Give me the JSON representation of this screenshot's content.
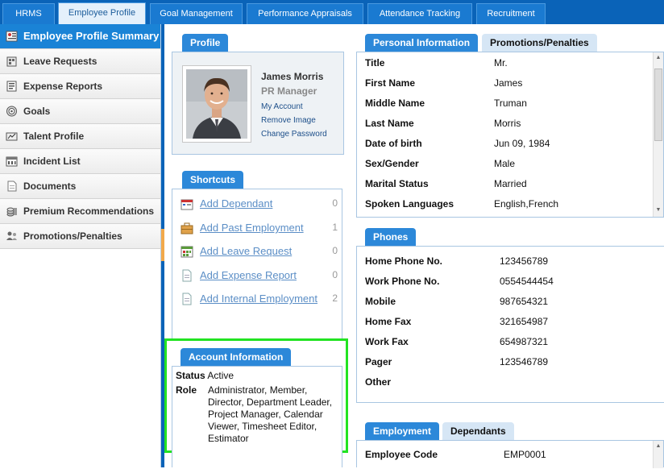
{
  "nav": {
    "tabs": [
      {
        "label": "HRMS"
      },
      {
        "label": "Employee Profile"
      },
      {
        "label": "Goal Management"
      },
      {
        "label": "Performance Appraisals"
      },
      {
        "label": "Attendance Tracking"
      },
      {
        "label": "Recruitment"
      }
    ]
  },
  "sidebar": {
    "items": [
      {
        "label": "Employee Profile Summary",
        "icon": "profile-summary-icon"
      },
      {
        "label": "Leave Requests",
        "icon": "leave-icon"
      },
      {
        "label": "Expense Reports",
        "icon": "expense-icon"
      },
      {
        "label": "Goals",
        "icon": "goals-icon"
      },
      {
        "label": "Talent Profile",
        "icon": "talent-icon"
      },
      {
        "label": "Incident List",
        "icon": "incident-icon"
      },
      {
        "label": "Documents",
        "icon": "documents-icon"
      },
      {
        "label": "Premium Recommendations",
        "icon": "premium-icon"
      },
      {
        "label": "Promotions/Penalties",
        "icon": "promotions-icon"
      }
    ]
  },
  "profile": {
    "tab": "Profile",
    "name": "James Morris",
    "role": "PR Manager",
    "links": [
      "My Account",
      "Remove Image",
      "Change Password"
    ]
  },
  "shortcuts": {
    "tab": "Shortcuts",
    "items": [
      {
        "label": "Add Dependant",
        "count": "0"
      },
      {
        "label": "Add Past Employment",
        "count": "1"
      },
      {
        "label": "Add Leave Request",
        "count": "0"
      },
      {
        "label": "Add Expense Report",
        "count": "0"
      },
      {
        "label": "Add Internal Employment",
        "count": "2"
      }
    ]
  },
  "account": {
    "tab": "Account Information",
    "status_label": "Status",
    "status_value": "Active",
    "role_label": "Role",
    "role_lines": [
      "Administrator, Member,",
      "Director, Department Leader,",
      "Project Manager, Calendar",
      "Viewer, Timesheet Editor,",
      "Estimator"
    ]
  },
  "personal": {
    "tab_active": "Personal Information",
    "tab_other": "Promotions/Penalties",
    "rows": [
      {
        "k": "Title",
        "v": "Mr."
      },
      {
        "k": "First Name",
        "v": "James"
      },
      {
        "k": "Middle Name",
        "v": "Truman"
      },
      {
        "k": "Last Name",
        "v": "Morris"
      },
      {
        "k": "Date of birth",
        "v": "Jun 09, 1984"
      },
      {
        "k": "Sex/Gender",
        "v": "Male"
      },
      {
        "k": "Marital Status",
        "v": "Married"
      },
      {
        "k": "Spoken Languages",
        "v": "English,French"
      }
    ]
  },
  "phones": {
    "tab": "Phones",
    "rows": [
      {
        "k": "Home Phone No.",
        "v": "123456789"
      },
      {
        "k": "Work Phone No.",
        "v": "0554544454"
      },
      {
        "k": "Mobile",
        "v": "987654321"
      },
      {
        "k": "Home Fax",
        "v": "321654987"
      },
      {
        "k": "Work Fax",
        "v": "654987321"
      },
      {
        "k": "Pager",
        "v": "123546789"
      },
      {
        "k": "Other",
        "v": ""
      }
    ]
  },
  "employment": {
    "tab_active": "Employment",
    "tab_other": "Dependants",
    "rows": [
      {
        "k": "Employee Code",
        "v": "EMP0001"
      }
    ]
  },
  "colors": {
    "nav_bg": "#0a63b8",
    "accent": "#2c88d9",
    "highlight": "#22e322"
  }
}
